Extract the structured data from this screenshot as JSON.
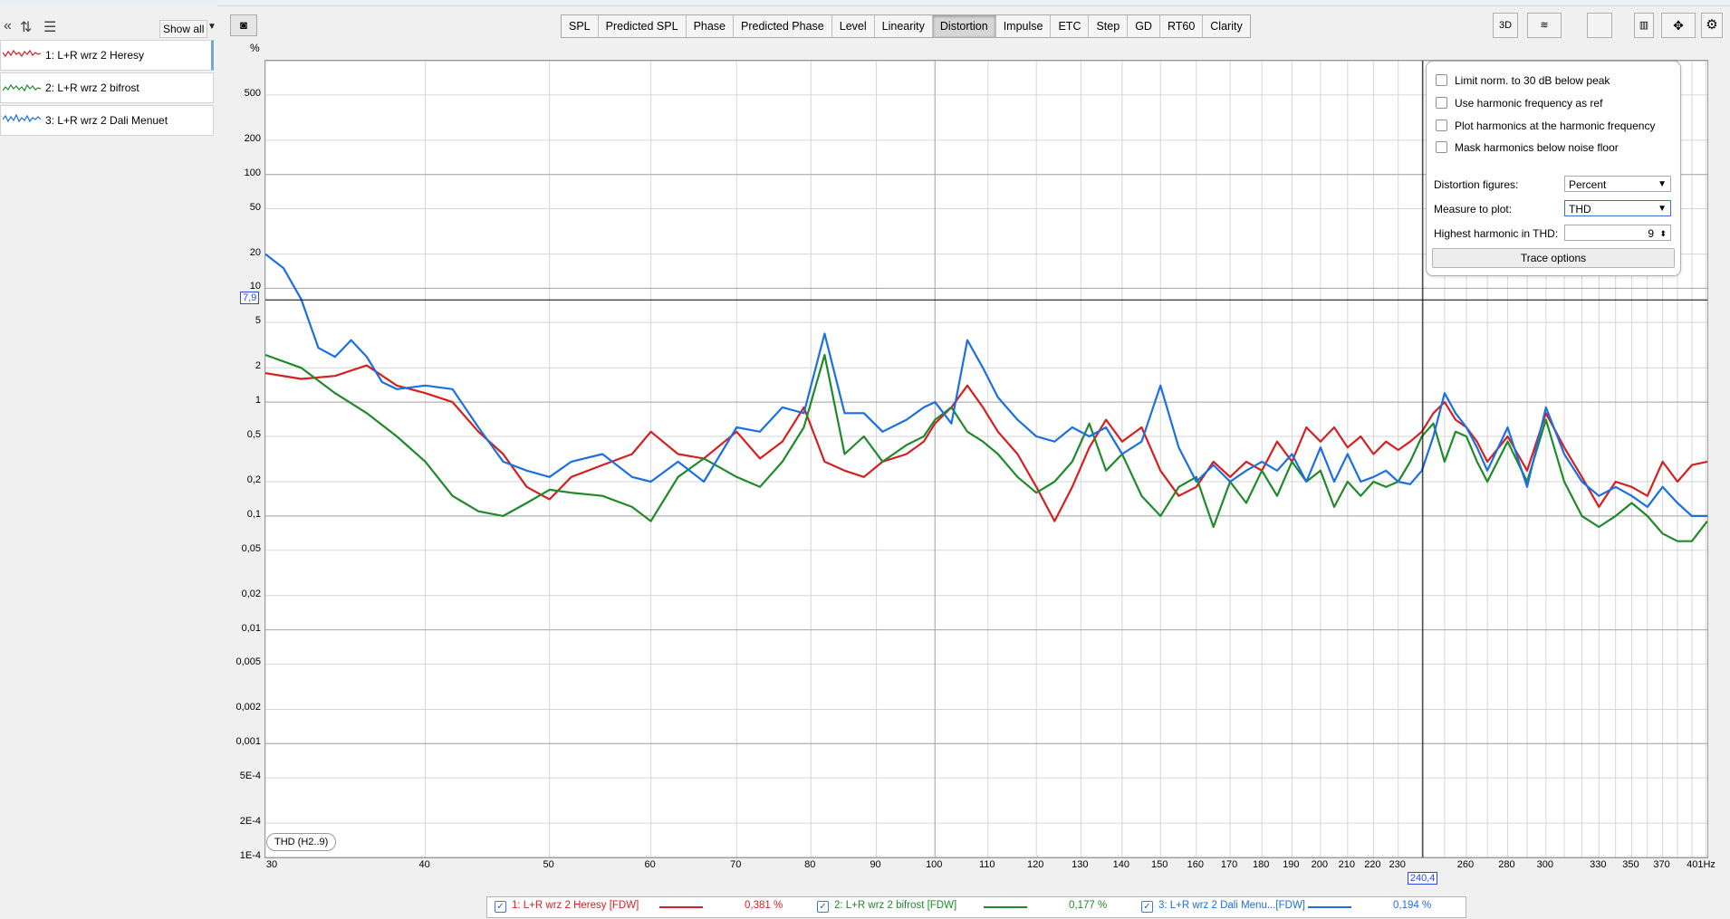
{
  "toolbar": {
    "show_all_label": "Show all"
  },
  "traces": [
    {
      "label": "1: L+R wrz 2 Heresy",
      "color": "#d42020",
      "selected": true
    },
    {
      "label": "2: L+R wrz 2 bifrost",
      "color": "#1e8a2a",
      "selected": false
    },
    {
      "label": "3: L+R wrz 2 Dali Menuet",
      "color": "#1c6fe0",
      "selected": false
    }
  ],
  "tabs": [
    {
      "label": "SPL"
    },
    {
      "label": "Predicted SPL"
    },
    {
      "label": "Phase"
    },
    {
      "label": "Predicted Phase"
    },
    {
      "label": "Level"
    },
    {
      "label": "Linearity"
    },
    {
      "label": "Distortion",
      "active": true
    },
    {
      "label": "Impulse"
    },
    {
      "label": "ETC"
    },
    {
      "label": "Step"
    },
    {
      "label": "GD"
    },
    {
      "label": "RT60"
    },
    {
      "label": "Clarity"
    }
  ],
  "right_tools": {
    "three_d": "3D"
  },
  "options": {
    "checkboxes": [
      "Limit norm. to 30 dB below peak",
      "Use harmonic frequency as ref",
      "Plot harmonics at the harmonic frequency",
      "Mask harmonics below noise floor"
    ],
    "distortion_figures_label": "Distortion figures:",
    "distortion_figures_value": "Percent",
    "measure_label": "Measure to plot:",
    "measure_value": "THD",
    "highest_harmonic_label": "Highest harmonic in THD:",
    "highest_harmonic_value": "9",
    "trace_options_label": "Trace options"
  },
  "cursor": {
    "y_value": "7,9",
    "x_value": "240,4"
  },
  "thd_badge": "THD (H2..9)",
  "legend": [
    {
      "label": "1: L+R wrz 2 Heresy [FDW]",
      "value": "0,381 %",
      "color": "#d42020"
    },
    {
      "label": "2: L+R wrz 2 bifrost [FDW]",
      "value": "0,177 %",
      "color": "#1e8a2a"
    },
    {
      "label": "3: L+R wrz 2 Dali Menu...[FDW]",
      "value": "0,194 %",
      "color": "#1c6fe0"
    }
  ],
  "chart_data": {
    "type": "line",
    "title": "",
    "xlabel": "",
    "ylabel": "%",
    "x_unit": "Hz",
    "x_scale": "log",
    "y_scale": "log",
    "xlim": [
      30,
      401
    ],
    "ylim": [
      0.0001,
      1000
    ],
    "y_ticks": [
      "500",
      "200",
      "100",
      "50",
      "20",
      "10",
      "5",
      "2",
      "1",
      "0,5",
      "0,2",
      "0,1",
      "0,05",
      "0,02",
      "0,01",
      "0,005",
      "0,002",
      "0,001",
      "5E-4",
      "2E-4",
      "1E-4"
    ],
    "y_tick_values": [
      500,
      200,
      100,
      50,
      20,
      10,
      5,
      2,
      1,
      0.5,
      0.2,
      0.1,
      0.05,
      0.02,
      0.01,
      0.005,
      0.002,
      0.001,
      0.0005,
      0.0002,
      0.0001
    ],
    "x_ticks": [
      "30",
      "40",
      "50",
      "60",
      "70",
      "80",
      "90",
      "100",
      "110",
      "120",
      "130",
      "140",
      "150",
      "160",
      "170",
      "180",
      "190",
      "200",
      "210",
      "220",
      "230",
      "240,4",
      "260",
      "280",
      "300",
      "330",
      "350",
      "370",
      "401Hz"
    ],
    "x_tick_values": [
      30,
      40,
      50,
      60,
      70,
      80,
      90,
      100,
      110,
      120,
      130,
      140,
      150,
      160,
      170,
      180,
      190,
      200,
      210,
      220,
      230,
      240.4,
      260,
      280,
      300,
      330,
      350,
      370,
      401
    ],
    "series": [
      {
        "name": "1: L+R wrz 2 Heresy [FDW]",
        "color": "#d42020",
        "x": [
          30,
          32,
          34,
          36,
          38,
          40,
          42,
          44,
          46,
          48,
          50,
          52,
          55,
          58,
          60,
          63,
          66,
          70,
          73,
          76,
          79,
          82,
          85,
          88,
          91,
          95,
          98,
          100,
          103,
          106,
          109,
          112,
          116,
          120,
          124,
          128,
          132,
          136,
          140,
          145,
          150,
          155,
          160,
          165,
          170,
          175,
          180,
          185,
          190,
          195,
          200,
          205,
          210,
          215,
          220,
          225,
          230,
          235,
          240,
          245,
          250,
          255,
          260,
          265,
          270,
          280,
          290,
          300,
          310,
          320,
          330,
          340,
          350,
          360,
          370,
          380,
          390,
          401
        ],
        "y": [
          1.8,
          1.6,
          1.7,
          2.1,
          1.4,
          1.2,
          1.0,
          0.55,
          0.35,
          0.18,
          0.14,
          0.22,
          0.28,
          0.35,
          0.55,
          0.35,
          0.32,
          0.55,
          0.32,
          0.45,
          0.9,
          0.3,
          0.25,
          0.22,
          0.3,
          0.35,
          0.45,
          0.65,
          0.9,
          1.4,
          0.9,
          0.55,
          0.35,
          0.18,
          0.09,
          0.18,
          0.4,
          0.7,
          0.45,
          0.6,
          0.25,
          0.15,
          0.18,
          0.3,
          0.22,
          0.3,
          0.25,
          0.45,
          0.3,
          0.6,
          0.45,
          0.6,
          0.4,
          0.5,
          0.35,
          0.45,
          0.38,
          0.45,
          0.55,
          0.8,
          1.0,
          0.7,
          0.6,
          0.45,
          0.3,
          0.5,
          0.25,
          0.8,
          0.4,
          0.22,
          0.12,
          0.2,
          0.18,
          0.15,
          0.3,
          0.2,
          0.28,
          0.3
        ]
      },
      {
        "name": "2: L+R wrz 2 bifrost [FDW]",
        "color": "#1e8a2a",
        "x": [
          30,
          32,
          34,
          36,
          38,
          40,
          42,
          44,
          46,
          48,
          50,
          52,
          55,
          58,
          60,
          63,
          66,
          70,
          73,
          76,
          79,
          82,
          85,
          88,
          91,
          95,
          98,
          100,
          103,
          106,
          109,
          112,
          116,
          120,
          124,
          128,
          132,
          136,
          140,
          145,
          150,
          155,
          160,
          165,
          170,
          175,
          180,
          185,
          190,
          195,
          200,
          205,
          210,
          215,
          220,
          225,
          230,
          235,
          240,
          245,
          250,
          255,
          260,
          265,
          270,
          280,
          290,
          300,
          310,
          320,
          330,
          340,
          350,
          360,
          370,
          380,
          390,
          401
        ],
        "y": [
          2.6,
          2.0,
          1.2,
          0.8,
          0.5,
          0.3,
          0.15,
          0.11,
          0.1,
          0.13,
          0.17,
          0.16,
          0.15,
          0.12,
          0.09,
          0.22,
          0.32,
          0.22,
          0.18,
          0.3,
          0.6,
          2.6,
          0.35,
          0.5,
          0.3,
          0.42,
          0.5,
          0.7,
          0.9,
          0.55,
          0.45,
          0.35,
          0.22,
          0.16,
          0.2,
          0.3,
          0.65,
          0.25,
          0.35,
          0.15,
          0.1,
          0.18,
          0.22,
          0.08,
          0.2,
          0.13,
          0.25,
          0.15,
          0.3,
          0.2,
          0.25,
          0.12,
          0.2,
          0.15,
          0.2,
          0.18,
          0.2,
          0.3,
          0.5,
          0.65,
          0.3,
          0.55,
          0.5,
          0.3,
          0.2,
          0.45,
          0.2,
          0.7,
          0.2,
          0.1,
          0.08,
          0.1,
          0.13,
          0.1,
          0.07,
          0.06,
          0.06,
          0.09
        ]
      },
      {
        "name": "3: L+R wrz 2 Dali Menu...[FDW]",
        "color": "#1c6fe0",
        "x": [
          30,
          31,
          32,
          33,
          34,
          35,
          36,
          37,
          38,
          40,
          42,
          44,
          46,
          48,
          50,
          52,
          55,
          58,
          60,
          63,
          66,
          70,
          73,
          76,
          79,
          82,
          85,
          88,
          91,
          95,
          98,
          100,
          103,
          106,
          109,
          112,
          116,
          120,
          124,
          128,
          132,
          136,
          140,
          145,
          150,
          155,
          160,
          165,
          170,
          175,
          180,
          185,
          190,
          195,
          200,
          205,
          210,
          215,
          220,
          225,
          230,
          235,
          240,
          245,
          250,
          255,
          260,
          265,
          270,
          280,
          290,
          300,
          310,
          320,
          330,
          340,
          350,
          360,
          370,
          380,
          390,
          401
        ],
        "y": [
          20,
          15,
          8,
          3,
          2.5,
          3.5,
          2.5,
          1.5,
          1.3,
          1.4,
          1.3,
          0.6,
          0.3,
          0.25,
          0.22,
          0.3,
          0.35,
          0.22,
          0.2,
          0.3,
          0.2,
          0.6,
          0.55,
          0.9,
          0.8,
          4.0,
          0.8,
          0.8,
          0.55,
          0.7,
          0.9,
          1.0,
          0.65,
          3.5,
          2.0,
          1.1,
          0.7,
          0.5,
          0.45,
          0.6,
          0.5,
          0.6,
          0.35,
          0.45,
          1.4,
          0.4,
          0.2,
          0.28,
          0.2,
          0.25,
          0.3,
          0.25,
          0.35,
          0.2,
          0.4,
          0.2,
          0.35,
          0.2,
          0.22,
          0.25,
          0.2,
          0.19,
          0.25,
          0.5,
          1.2,
          0.8,
          0.6,
          0.4,
          0.25,
          0.6,
          0.18,
          0.9,
          0.35,
          0.2,
          0.15,
          0.18,
          0.15,
          0.12,
          0.18,
          0.13,
          0.1,
          0.1
        ]
      }
    ]
  }
}
